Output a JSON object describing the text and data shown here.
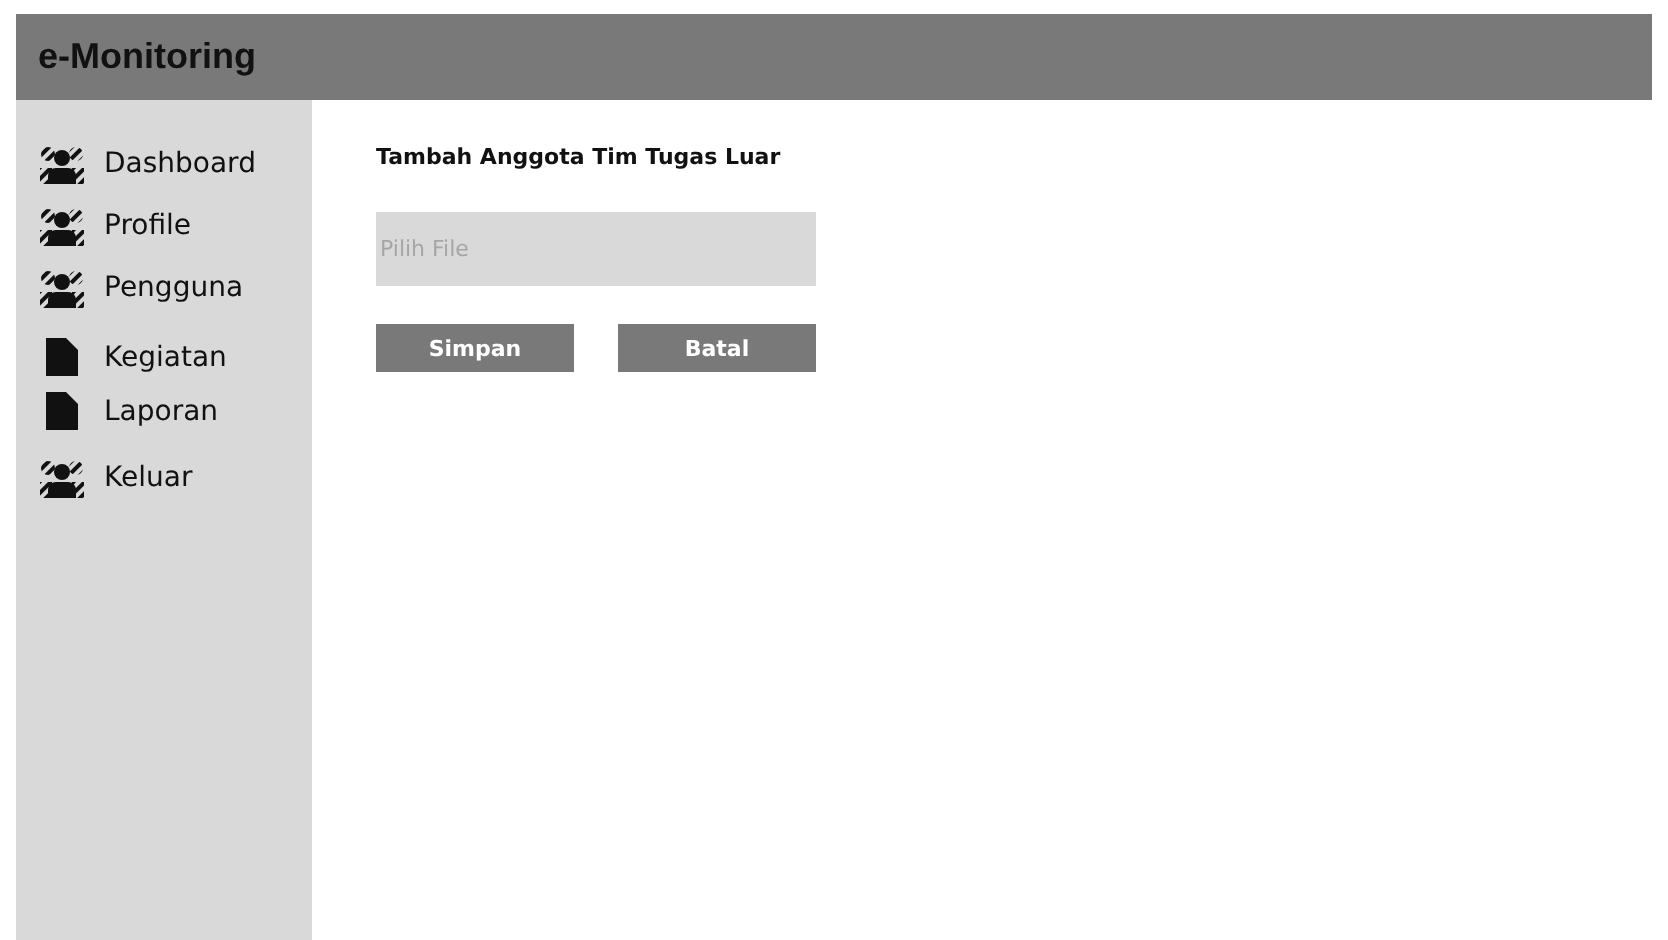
{
  "app": {
    "title": "e-Monitoring"
  },
  "sidebar": {
    "items": [
      {
        "label": "Dashboard",
        "kind": "users"
      },
      {
        "label": "Profile",
        "kind": "users"
      },
      {
        "label": "Pengguna",
        "kind": "users"
      },
      {
        "label": "Kegiatan",
        "kind": "file"
      },
      {
        "label": "Laporan",
        "kind": "file"
      },
      {
        "label": "Keluar",
        "kind": "users"
      }
    ]
  },
  "form": {
    "title": "Tambah Anggota Tim Tugas Luar",
    "file_field": {
      "placeholder": "Pilih File"
    },
    "buttons": [
      "Simpan",
      "Batal"
    ]
  }
}
